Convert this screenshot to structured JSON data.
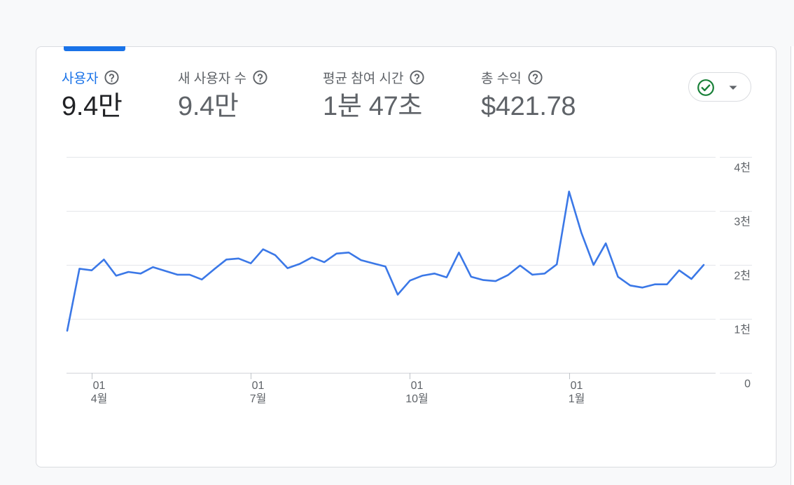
{
  "metrics": [
    {
      "label": "사용자",
      "value": "9.4만"
    },
    {
      "label": "새 사용자 수",
      "value": "9.4만"
    },
    {
      "label": "평균 참여 시간",
      "value": "1분 47초"
    },
    {
      "label": "총 수익",
      "value": "$421.78"
    }
  ],
  "icons": {
    "help": "help-circle-icon",
    "status": "check-circle-icon",
    "dropdown": "chevron-down-icon"
  },
  "colors": {
    "accent": "#1a73e8",
    "series": "#3b78e7",
    "status_check": "#188038"
  },
  "chart_data": {
    "type": "line",
    "title": "",
    "xlabel": "",
    "ylabel": "",
    "ylim": [
      0,
      4000
    ],
    "grid": true,
    "y_axis_position": "right",
    "y_ticks": [
      {
        "value": 0,
        "label": "0"
      },
      {
        "value": 1000,
        "label": "1천"
      },
      {
        "value": 2000,
        "label": "2천"
      },
      {
        "value": 3000,
        "label": "3천"
      },
      {
        "value": 4000,
        "label": "4천"
      }
    ],
    "x_ticks": [
      {
        "index": 2,
        "day": "01",
        "month": "4월"
      },
      {
        "index": 15,
        "day": "01",
        "month": "7월"
      },
      {
        "index": 28,
        "day": "01",
        "month": "10월"
      },
      {
        "index": 41,
        "day": "01",
        "month": "1월"
      }
    ],
    "series": [
      {
        "values": [
          780,
          1930,
          1900,
          2100,
          1800,
          1870,
          1840,
          1960,
          1890,
          1820,
          1820,
          1730,
          1920,
          2100,
          2120,
          2030,
          2290,
          2180,
          1940,
          2020,
          2140,
          2050,
          2210,
          2230,
          2090,
          2030,
          1970,
          1450,
          1710,
          1800,
          1840,
          1770,
          2230,
          1780,
          1720,
          1700,
          1810,
          1990,
          1820,
          1840,
          2010,
          3360,
          2600,
          2000,
          2400,
          1780,
          1620,
          1580,
          1640,
          1640,
          1900,
          1740,
          2000
        ]
      }
    ]
  }
}
